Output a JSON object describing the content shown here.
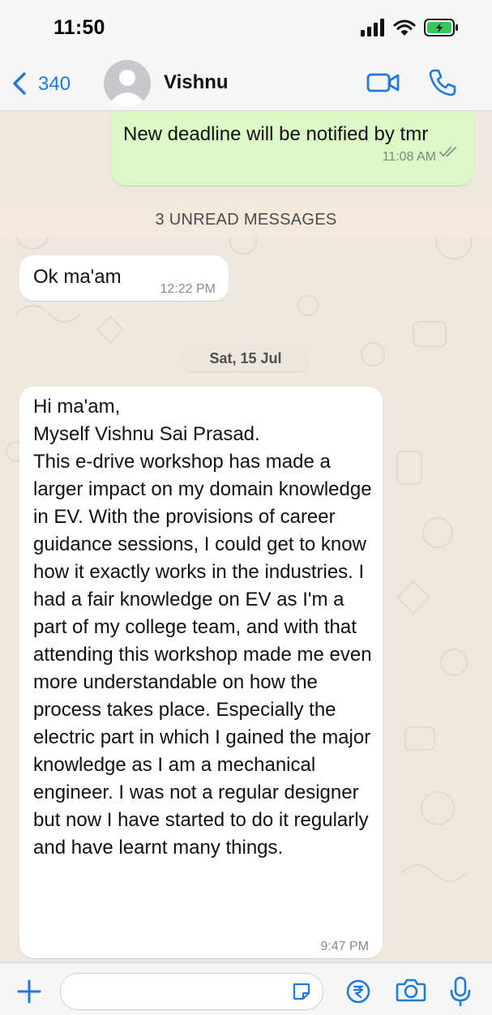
{
  "status_bar": {
    "time": "11:50"
  },
  "header": {
    "back_count": "340",
    "contact_name": "Vishnu"
  },
  "messages": [
    {
      "direction": "outgoing",
      "text": "New deadline will be notified by tmr",
      "time": "11:08 AM"
    },
    {
      "direction": "incoming",
      "text": "Ok ma'am",
      "time": "12:22 PM"
    },
    {
      "direction": "incoming",
      "text": "Hi ma'am,\nMyself Vishnu Sai Prasad.\nThis e-drive workshop has made a larger impact on my domain knowledge in EV. With the provisions of career guidance sessions, I could get to know how it exactly works in the industries. I had a fair knowledge on EV as I'm a part of my college team, and with that attending this workshop made me even more understandable on how the process takes place. Especially the electric part in which I gained the major knowledge as I am a mechanical engineer. I was not a regular designer but now I have started to do it regularly and have learnt many things.",
      "time": "9:47 PM"
    }
  ],
  "unread_label": "3 UNREAD MESSAGES",
  "date_label": "Sat, 15 Jul",
  "icons": {
    "signal": "signal-icon",
    "wifi": "wifi-icon",
    "battery": "battery-charging-icon",
    "back": "chevron-left-icon",
    "video": "video-call-icon",
    "phone": "phone-icon",
    "plus": "plus-icon",
    "sticker": "sticker-icon",
    "rupee": "rupee-icon",
    "camera": "camera-icon",
    "mic": "microphone-icon"
  },
  "colors": {
    "accent": "#1f7ae0",
    "outgoing_bubble": "#dcf8c6",
    "incoming_bubble": "#ffffff",
    "chat_background": "#efe8df",
    "battery_fill": "#35c759"
  }
}
